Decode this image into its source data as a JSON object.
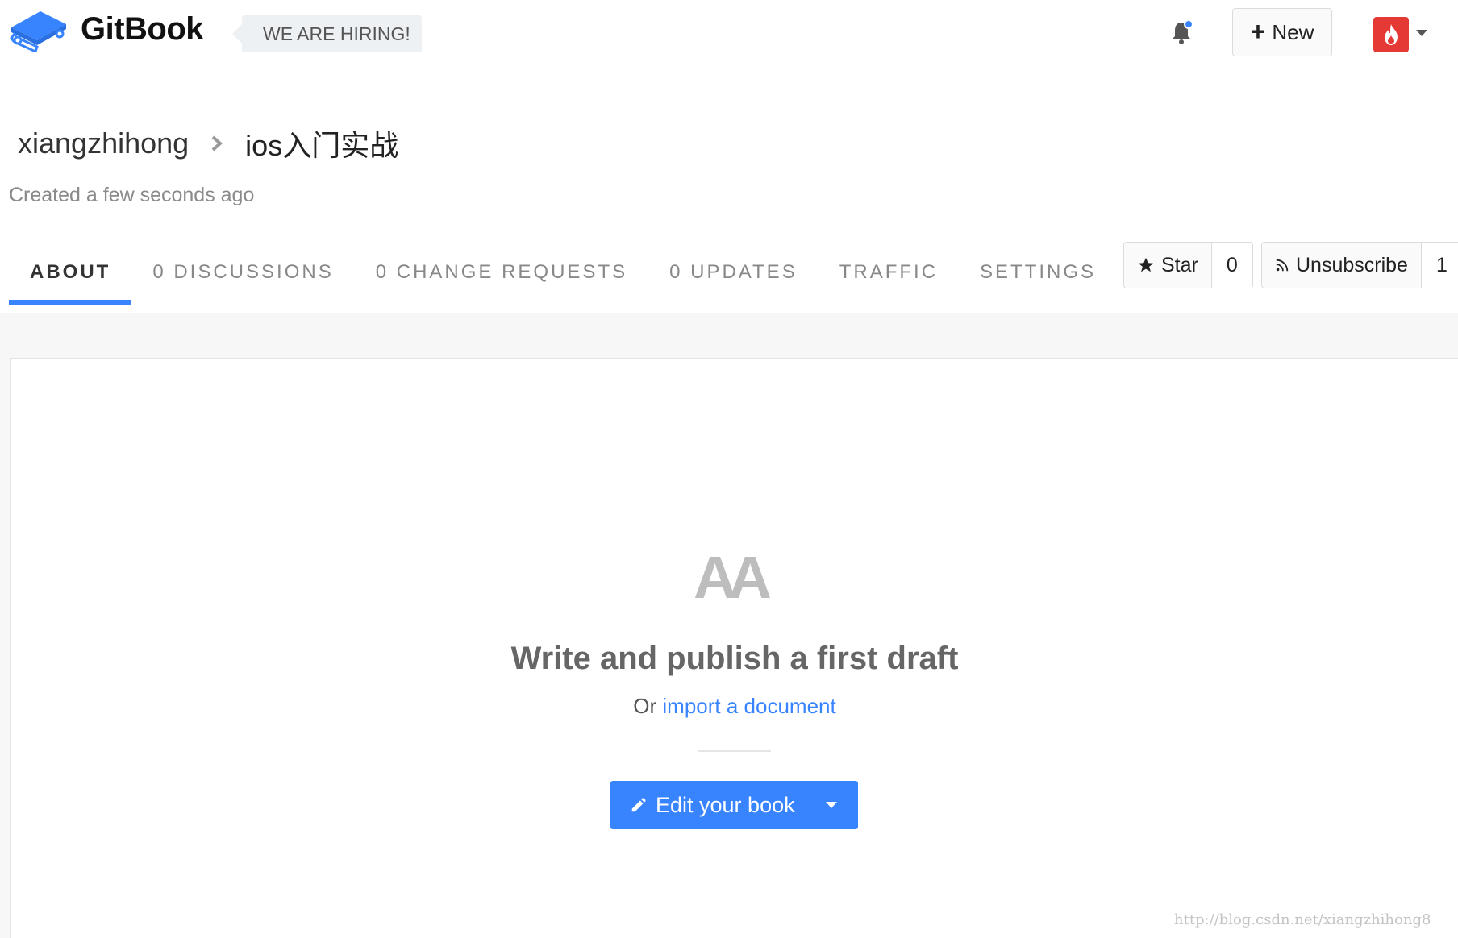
{
  "header": {
    "logo_text": "GitBook",
    "hiring_badge": "WE ARE HIRING!",
    "notification_dot_color": "#3884ff",
    "new_button_label": "New",
    "avatar_color": "#e53935"
  },
  "breadcrumb": {
    "owner": "xiangzhihong",
    "book": "ios入门实战"
  },
  "meta": {
    "created": "Created a few seconds ago"
  },
  "tabs": [
    {
      "label": "ABOUT",
      "active": true
    },
    {
      "label": "0 DISCUSSIONS",
      "active": false
    },
    {
      "label": "0 CHANGE REQUESTS",
      "active": false
    },
    {
      "label": "0 UPDATES",
      "active": false
    },
    {
      "label": "TRAFFIC",
      "active": false
    },
    {
      "label": "SETTINGS",
      "active": false
    }
  ],
  "actions": {
    "star_label": "Star",
    "star_count": "0",
    "subscribe_label": "Unsubscribe",
    "subscribe_count": "1"
  },
  "empty_state": {
    "icon_text": "AA",
    "title": "Write and publish a first draft",
    "subtitle_prefix": "Or",
    "subtitle_link": "import a document",
    "edit_button_label": "Edit your book"
  },
  "watermark": "http://blog.csdn.net/xiangzhihong8",
  "colors": {
    "accent": "#3884ff",
    "muted_text": "#888888"
  }
}
